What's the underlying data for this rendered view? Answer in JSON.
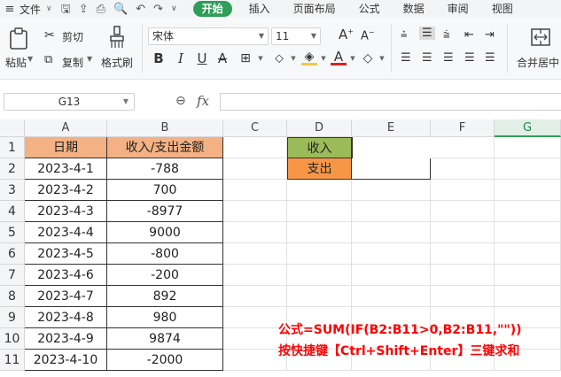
{
  "menubar": {
    "file_label": "文件",
    "tabs": [
      "开始",
      "插入",
      "页面布局",
      "公式",
      "数据",
      "审阅",
      "视图"
    ],
    "active_tab": "开始"
  },
  "ribbon": {
    "paste_label": "粘贴",
    "cut_label": "剪切",
    "copy_label": "复制",
    "format_painter_label": "格式刷",
    "font_name": "宋体",
    "font_size": "11",
    "merge_label": "合并居中"
  },
  "formula_bar": {
    "cell_ref": "G13",
    "fx_label": "fx",
    "formula": ""
  },
  "sheet": {
    "columns": [
      "A",
      "B",
      "C",
      "D",
      "E",
      "F",
      "G"
    ],
    "selected_column": "G",
    "rows": [
      "1",
      "2",
      "3",
      "4",
      "5",
      "6",
      "7",
      "8",
      "9",
      "10",
      "11"
    ],
    "header_date": "日期",
    "header_amount": "收入/支出金额",
    "dates": [
      "2023-4-1",
      "2023-4-2",
      "2023-4-3",
      "2023-4-4",
      "2023-4-5",
      "2023-4-6",
      "2023-4-7",
      "2023-4-8",
      "2023-4-9",
      "2023-4-10"
    ],
    "amounts": [
      "-788",
      "700",
      "-8977",
      "9000",
      "-800",
      "-200",
      "892",
      "980",
      "9874",
      "-2000"
    ],
    "income_label": "收入",
    "expense_label": "支出",
    "income_value": "",
    "expense_value": ""
  },
  "annotation": {
    "line1": "公式=SUM(IF(B2:B11>0,B2:B11,\"\"))",
    "line2": "按快捷键【Ctrl+Shift+Enter】三键求和"
  },
  "colors": {
    "accent": "#2f9e59",
    "header_fill": "#f4b183",
    "income_fill": "#9bbb59",
    "expense_fill": "#f79646",
    "annotation": "#ff0000"
  }
}
